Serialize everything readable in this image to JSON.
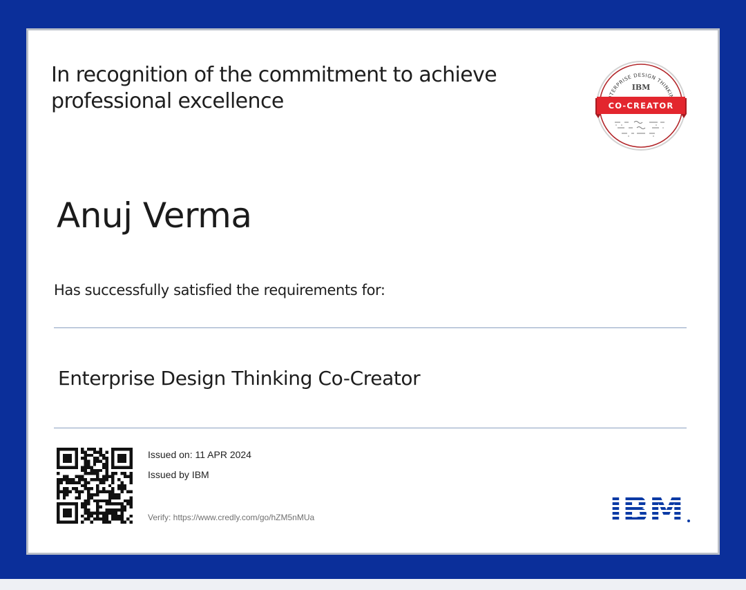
{
  "certificate": {
    "headline": "In recognition of the commitment to achieve professional excellence",
    "recipient_name": "Anuj Verma",
    "requirements_text": "Has successfully satisfied the requirements for:",
    "course_title": "Enterprise Design Thinking Co-Creator",
    "issued_on": "Issued on: 11 APR 2024",
    "issued_by": "Issued by IBM",
    "verify": "Verify: https://www.credly.com/go/hZM5nMUa"
  },
  "badge": {
    "arc_text": "ENTERPRISE DESIGN THINKING",
    "brand": "IBM",
    "ribbon_label": "CO-CREATOR",
    "ribbon_color": "#e3262e",
    "icon": "badge-seal"
  },
  "logo": {
    "icon": "ibm-logo",
    "brand_color": "#0a3aa5"
  },
  "colors": {
    "frame": "#0b2f9a",
    "card": "#ffffff",
    "rule": "#8aa0c0"
  }
}
